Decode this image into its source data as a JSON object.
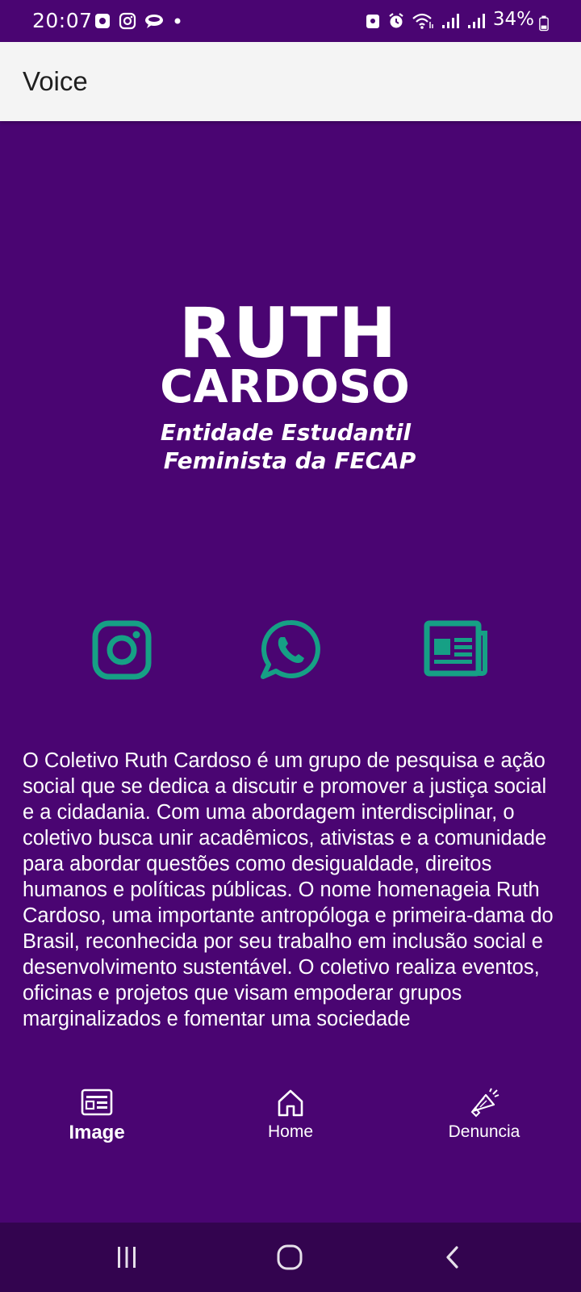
{
  "status_bar": {
    "time": "20:07",
    "battery": "34%",
    "left_icons": [
      "notification-square-icon",
      "instagram-icon",
      "chat-bubble-icon",
      "dot-icon"
    ],
    "right_icons": [
      "lock-screen-icon",
      "alarm-icon",
      "wifi-icon",
      "signal-icon",
      "signal-icon",
      "battery-icon"
    ]
  },
  "app_bar": {
    "title": "Voice"
  },
  "logo": {
    "line1": "RUTH",
    "line2": "CARDOSO",
    "line3": "Entidade Estudantil",
    "line4": "Feminista da FECAP"
  },
  "social": {
    "icons": [
      "instagram-icon",
      "whatsapp-icon",
      "newspaper-icon"
    ],
    "accent_color": "#16a085"
  },
  "description": "O Coletivo Ruth Cardoso é um grupo de pesquisa e ação social que se dedica a discutir e promover a justiça social e a cidadania. Com uma abordagem interdisciplinar, o coletivo busca unir acadêmicos, ativistas e a comunidade para abordar questões como desigualdade, direitos humanos e políticas públicas. O nome homenageia Ruth Cardoso, uma importante antropóloga e primeira-dama do Brasil, reconhecida por seu trabalho em inclusão social e desenvolvimento sustentável. O coletivo realiza eventos, oficinas e projetos que visam empoderar grupos marginalizados e fomentar uma sociedade",
  "bottom_nav": {
    "items": [
      {
        "label": "Image",
        "icon": "newspaper-icon",
        "active": true
      },
      {
        "label": "Home",
        "icon": "home-icon",
        "active": false
      },
      {
        "label": "Denuncia",
        "icon": "megaphone-icon",
        "active": false
      }
    ]
  },
  "theme": {
    "background": "#4a0572",
    "app_bar_bg": "#f4f4f4",
    "system_nav_bg": "#33044f",
    "accent": "#16a085"
  }
}
